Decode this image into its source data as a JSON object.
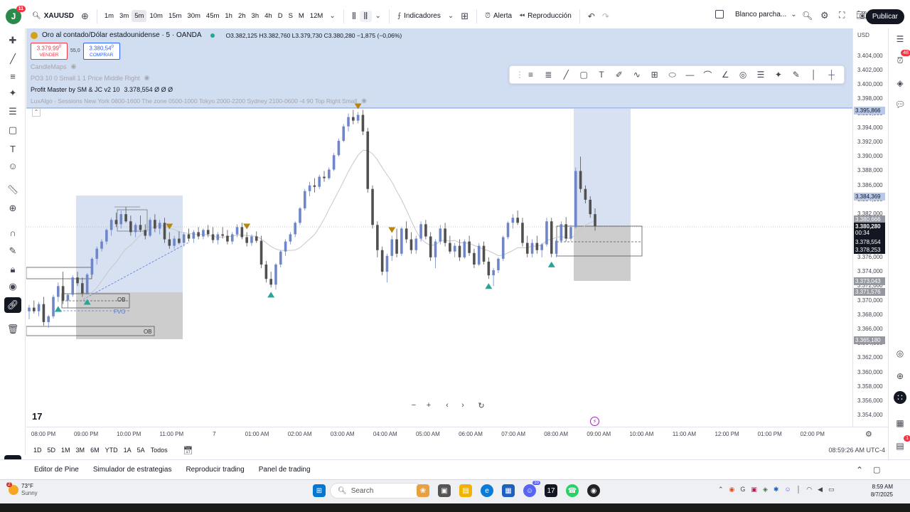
{
  "toolbar": {
    "avatar_letter": "J",
    "notification_count": "11",
    "symbol": "XAUUSD",
    "intervals": [
      "1m",
      "3m",
      "5m",
      "10m",
      "15m",
      "30m",
      "45m",
      "1h",
      "2h",
      "3h",
      "4h",
      "D",
      "S",
      "M",
      "12M"
    ],
    "active_interval": "5m",
    "indicators_label": "Indicadores",
    "alert_label": "Alerta",
    "replay_label": "Reproducción",
    "layout_label": "Blanco parcha...",
    "publish_label": "Publicar"
  },
  "legend": {
    "title": "Oro al contado/Dólar estadounidense · 5 · OANDA",
    "ohlc": "O3.382,125 H3.382,760 L3.379,730 C3.380,280 −1,875 (−0,06%)",
    "sell_price": "3.379,99",
    "sell_price_sup": "0",
    "sell_label": "VENDER",
    "spread": "55,0",
    "buy_price": "3.380,54",
    "buy_price_sup": "0",
    "buy_label": "COMPRAR",
    "indicator1": "CandleMaps",
    "indicator2": "PO3 10 0 Small 1 1 Price Middle Right",
    "indicator3": "Profit Master by SM & JC v2 10",
    "indicator3_values": "3.378,554 Ø Ø Ø",
    "indicator4": "LuxAlgo - Sessions New York 0800-1600 The zone 0500-1000 Tokyo 2000-2200 Sydney 2100-0600 -4 90 Top Right Small"
  },
  "chart_data": {
    "type": "candlestick",
    "symbol": "XAUUSD",
    "x_ticks": [
      "08:00 PM",
      "09:00 PM",
      "10:00 PM",
      "11:00 PM",
      "7",
      "01:00 AM",
      "02:00 AM",
      "03:00 AM",
      "04:00 AM",
      "05:00 AM",
      "06:00 AM",
      "07:00 AM",
      "08:00 AM",
      "09:00 AM",
      "10:00 AM",
      "11:00 AM",
      "12:00 PM",
      "01:00 PM",
      "02:00 PM"
    ],
    "y_ticks": [
      "3.404,000",
      "3.402,000",
      "3.400,000",
      "3.398,000",
      "3.396,000",
      "3.394,000",
      "3.392,000",
      "3.390,000",
      "3.388,000",
      "3.386,000",
      "3.384,000",
      "3.382,000",
      "3.380,000",
      "3.378,000",
      "3.376,000",
      "3.374,000",
      "3.372,000",
      "3.370,000",
      "3.368,000",
      "3.366,000",
      "3.364,000",
      "3.362,000",
      "3.360,000",
      "3.358,000",
      "3.356,000",
      "3.354,000"
    ],
    "ylim": [
      3353,
      3405
    ],
    "currency": "USD",
    "candles": [
      [
        3368.5,
        3369.4,
        3367.4,
        3369.0
      ],
      [
        3369.0,
        3370.0,
        3368.2,
        3368.5
      ],
      [
        3368.5,
        3369.8,
        3367.8,
        3369.5
      ],
      [
        3369.5,
        3370.5,
        3366.5,
        3367.0
      ],
      [
        3367.0,
        3368.0,
        3366.2,
        3367.8
      ],
      [
        3367.8,
        3370.8,
        3367.5,
        3370.5
      ],
      [
        3370.5,
        3372.5,
        3369.8,
        3372.0
      ],
      [
        3372.0,
        3374.0,
        3369.5,
        3370.0
      ],
      [
        3370.0,
        3371.0,
        3369.0,
        3370.8
      ],
      [
        3370.8,
        3373.5,
        3370.5,
        3373.2
      ],
      [
        3373.2,
        3374.0,
        3372.0,
        3372.4
      ],
      [
        3372.4,
        3373.2,
        3370.5,
        3371.0
      ],
      [
        3371.0,
        3373.8,
        3370.8,
        3373.6
      ],
      [
        3373.6,
        3376.0,
        3373.2,
        3375.8
      ],
      [
        3375.8,
        3377.5,
        3375.0,
        3377.2
      ],
      [
        3377.2,
        3378.5,
        3376.8,
        3378.2
      ],
      [
        3378.2,
        3380.0,
        3377.8,
        3379.8
      ],
      [
        3379.8,
        3381.5,
        3379.0,
        3381.2
      ],
      [
        3381.2,
        3382.2,
        3380.2,
        3380.6
      ],
      [
        3380.6,
        3382.5,
        3380.0,
        3382.0
      ],
      [
        3382.0,
        3383.0,
        3380.8,
        3381.0
      ],
      [
        3381.0,
        3381.8,
        3379.0,
        3379.5
      ],
      [
        3379.5,
        3380.8,
        3378.8,
        3380.5
      ],
      [
        3380.5,
        3381.8,
        3379.5,
        3379.8
      ],
      [
        3379.8,
        3380.6,
        3378.5,
        3379.0
      ],
      [
        3379.0,
        3381.5,
        3378.8,
        3381.2
      ],
      [
        3381.2,
        3382.0,
        3379.5,
        3380.0
      ],
      [
        3380.0,
        3381.2,
        3379.2,
        3380.8
      ],
      [
        3380.8,
        3381.5,
        3378.0,
        3378.5
      ],
      [
        3378.5,
        3379.5,
        3377.2,
        3377.6
      ],
      [
        3377.6,
        3379.0,
        3377.2,
        3378.6
      ],
      [
        3378.6,
        3379.6,
        3377.8,
        3378.0
      ],
      [
        3378.0,
        3379.5,
        3377.5,
        3379.2
      ],
      [
        3379.2,
        3380.0,
        3378.2,
        3378.6
      ],
      [
        3378.6,
        3379.8,
        3378.0,
        3379.5
      ],
      [
        3379.5,
        3380.2,
        3378.5,
        3378.9
      ],
      [
        3378.9,
        3380.0,
        3378.5,
        3379.8
      ],
      [
        3379.8,
        3380.5,
        3378.8,
        3379.2
      ],
      [
        3379.2,
        3380.2,
        3378.0,
        3378.4
      ],
      [
        3378.4,
        3379.5,
        3377.8,
        3379.2
      ],
      [
        3379.2,
        3380.2,
        3378.6,
        3379.0
      ],
      [
        3379.0,
        3379.8,
        3377.8,
        3378.2
      ],
      [
        3378.2,
        3379.5,
        3377.8,
        3379.2
      ],
      [
        3379.2,
        3380.6,
        3378.8,
        3380.2
      ],
      [
        3380.2,
        3380.8,
        3378.5,
        3378.8
      ],
      [
        3378.8,
        3379.5,
        3377.5,
        3378.0
      ],
      [
        3378.0,
        3379.2,
        3377.6,
        3378.9
      ],
      [
        3378.9,
        3379.6,
        3378.0,
        3378.3
      ],
      [
        3378.3,
        3379.0,
        3374.5,
        3375.0
      ],
      [
        3375.0,
        3375.5,
        3372.5,
        3373.0
      ],
      [
        3373.0,
        3374.0,
        3371.8,
        3372.2
      ],
      [
        3372.2,
        3375.2,
        3371.5,
        3375.0
      ],
      [
        3375.0,
        3377.0,
        3374.6,
        3376.8
      ],
      [
        3376.8,
        3378.5,
        3376.2,
        3378.2
      ],
      [
        3378.2,
        3379.5,
        3377.8,
        3379.2
      ],
      [
        3379.2,
        3381.0,
        3378.8,
        3380.8
      ],
      [
        3380.8,
        3383.0,
        3380.5,
        3382.8
      ],
      [
        3382.8,
        3385.5,
        3382.5,
        3385.2
      ],
      [
        3385.2,
        3386.5,
        3384.5,
        3386.0
      ],
      [
        3386.0,
        3387.0,
        3385.0,
        3385.8
      ],
      [
        3385.8,
        3387.5,
        3385.5,
        3387.2
      ],
      [
        3387.2,
        3388.0,
        3386.5,
        3387.0
      ],
      [
        3387.0,
        3388.5,
        3386.8,
        3388.2
      ],
      [
        3388.2,
        3390.5,
        3388.0,
        3390.2
      ],
      [
        3390.2,
        3392.5,
        3390.0,
        3392.2
      ],
      [
        3392.2,
        3394.5,
        3392.0,
        3394.2
      ],
      [
        3394.2,
        3396.0,
        3393.5,
        3395.5
      ],
      [
        3395.5,
        3396.5,
        3394.5,
        3395.0
      ],
      [
        3395.0,
        3396.2,
        3394.6,
        3395.8
      ],
      [
        3395.8,
        3396.5,
        3393.0,
        3393.5
      ],
      [
        3393.5,
        3394.0,
        3385.0,
        3385.5
      ],
      [
        3385.5,
        3386.0,
        3380.0,
        3380.5
      ],
      [
        3380.5,
        3381.0,
        3376.0,
        3377.0
      ],
      [
        3377.0,
        3377.5,
        3373.5,
        3374.0
      ],
      [
        3374.0,
        3376.5,
        3372.5,
        3376.2
      ],
      [
        3376.2,
        3379.0,
        3375.5,
        3378.5
      ],
      [
        3378.5,
        3380.0,
        3376.0,
        3376.5
      ],
      [
        3376.5,
        3380.2,
        3376.2,
        3380.0
      ],
      [
        3380.0,
        3381.0,
        3378.0,
        3378.5
      ],
      [
        3378.5,
        3379.5,
        3376.5,
        3377.0
      ],
      [
        3377.0,
        3379.0,
        3376.5,
        3378.6
      ],
      [
        3378.6,
        3381.0,
        3378.2,
        3380.6
      ],
      [
        3380.6,
        3381.2,
        3378.5,
        3378.9
      ],
      [
        3378.9,
        3379.5,
        3375.5,
        3376.0
      ],
      [
        3376.0,
        3378.5,
        3374.5,
        3378.2
      ],
      [
        3378.2,
        3380.5,
        3377.8,
        3380.0
      ],
      [
        3380.0,
        3380.8,
        3377.5,
        3378.0
      ],
      [
        3378.0,
        3379.0,
        3376.5,
        3376.8
      ],
      [
        3376.8,
        3378.0,
        3376.0,
        3377.6
      ],
      [
        3377.6,
        3378.5,
        3375.5,
        3376.0
      ],
      [
        3376.0,
        3378.5,
        3375.8,
        3378.2
      ],
      [
        3378.2,
        3379.0,
        3376.2,
        3376.6
      ],
      [
        3376.6,
        3377.2,
        3374.5,
        3375.0
      ],
      [
        3375.0,
        3378.0,
        3374.8,
        3377.6
      ],
      [
        3377.6,
        3378.2,
        3375.0,
        3375.4
      ],
      [
        3375.4,
        3376.0,
        3373.0,
        3373.5
      ],
      [
        3373.5,
        3374.5,
        3372.0,
        3374.2
      ],
      [
        3374.2,
        3376.0,
        3373.8,
        3375.8
      ],
      [
        3375.8,
        3379.0,
        3375.5,
        3378.8
      ],
      [
        3378.8,
        3381.0,
        3378.5,
        3380.8
      ],
      [
        3380.8,
        3382.0,
        3380.0,
        3381.5
      ],
      [
        3381.5,
        3382.5,
        3380.5,
        3380.8
      ],
      [
        3380.8,
        3381.5,
        3377.5,
        3378.0
      ],
      [
        3378.0,
        3379.0,
        3376.0,
        3376.5
      ],
      [
        3376.5,
        3378.5,
        3376.0,
        3378.0
      ],
      [
        3378.0,
        3379.0,
        3376.5,
        3377.0
      ],
      [
        3377.0,
        3378.0,
        3376.0,
        3377.8
      ],
      [
        3377.8,
        3381.5,
        3377.5,
        3381.0
      ],
      [
        3381.0,
        3381.5,
        3376.0,
        3376.5
      ],
      [
        3376.5,
        3378.5,
        3376.0,
        3378.3
      ],
      [
        3378.3,
        3381.0,
        3378.0,
        3380.6
      ],
      [
        3380.6,
        3381.6,
        3378.2,
        3378.6
      ],
      [
        3378.6,
        3380.5,
        3378.3,
        3380.2
      ],
      [
        3380.2,
        3388.5,
        3380.0,
        3388.0
      ],
      [
        3388.0,
        3390.0,
        3385.0,
        3385.5
      ],
      [
        3385.5,
        3386.0,
        3383.5,
        3384.0
      ],
      [
        3384.0,
        3384.5,
        3381.5,
        3382.0
      ],
      [
        3382.0,
        3382.8,
        3379.7,
        3380.3
      ]
    ]
  },
  "price_labels": {
    "p1": "3.395,866",
    "p2": "3.384,369",
    "p3": "3.380,666",
    "current": "3.380,280",
    "countdown": "00:34",
    "p4": "3.378,554",
    "p5": "3.378,253",
    "p6": "3.373,043",
    "p7": "3.371,576",
    "p8": "3.365,180",
    "currency": "USD"
  },
  "zone_labels": {
    "ob1": "OB",
    "fvg": "FVG",
    "ob2": "OB"
  },
  "range_bar": {
    "ranges": [
      "1D",
      "5D",
      "1M",
      "3M",
      "6M",
      "YTD",
      "1A",
      "5A",
      "Todos"
    ],
    "clock": "08:59:26 AM UTC-4"
  },
  "bottom_panel": {
    "tabs": [
      "Editor de Pine",
      "Simulador de estrategias",
      "Reproducir trading",
      "Panel de trading"
    ]
  },
  "taskbar": {
    "weather_temp": "73°F",
    "weather_desc": "Sunny",
    "weather_badge": "2",
    "search_label": "Search",
    "time": "8:59 AM",
    "date": "8/7/2025",
    "app_badge": "33"
  },
  "right_badges": {
    "alerts": "48",
    "notif": "1"
  },
  "logo": "17",
  "colors": {
    "up": "#6f86c9",
    "down": "#505050",
    "zone_blue": "#c9d7ee",
    "zone_gray": "#b8b8b8",
    "current_price_bg": "#131722",
    "label_gray": "#9598a1",
    "label_blue": "#b9c8e8",
    "marker_gold": "#b8860b",
    "marker_green": "#26a69a"
  }
}
